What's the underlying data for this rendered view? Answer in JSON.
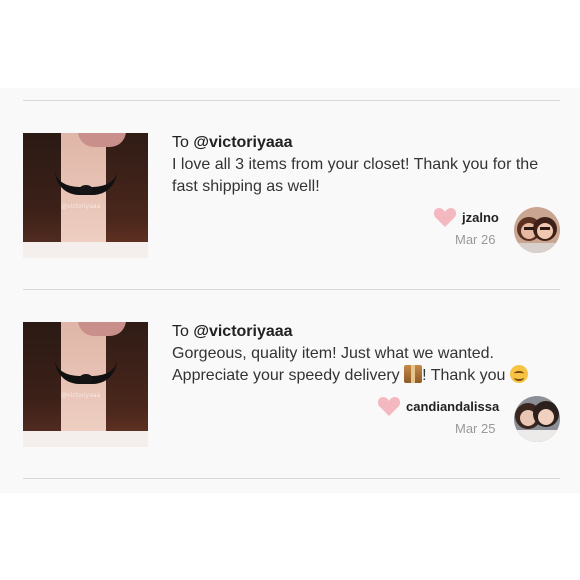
{
  "reviews": [
    {
      "to_prefix": "To ",
      "to_user": "@victoriyaaa",
      "text": "I love all 3 items from your closet! Thank you for the fast shipping as well!",
      "username": "jzalno",
      "date": "Mar 26",
      "photo_watermark": "@victoriyaaa"
    },
    {
      "to_prefix": "To ",
      "to_user": "@victoriyaaa",
      "text_line1": "Gorgeous, quality item! Just what we wanted.",
      "text_line2_a": "Appreciate your speedy delivery ",
      "text_line2_b": "! Thank you ",
      "username": "candiandalissa",
      "date": "Mar 25",
      "photo_watermark": "@victoriyaaa"
    }
  ],
  "icons": {
    "heart": "heart-icon",
    "package_emoji": "package-icon",
    "smile_emoji": "smile-icon"
  },
  "colors": {
    "heart": "#f4b8c0",
    "panel_bg": "#faf9fa",
    "divider": "#d9d9d9"
  }
}
